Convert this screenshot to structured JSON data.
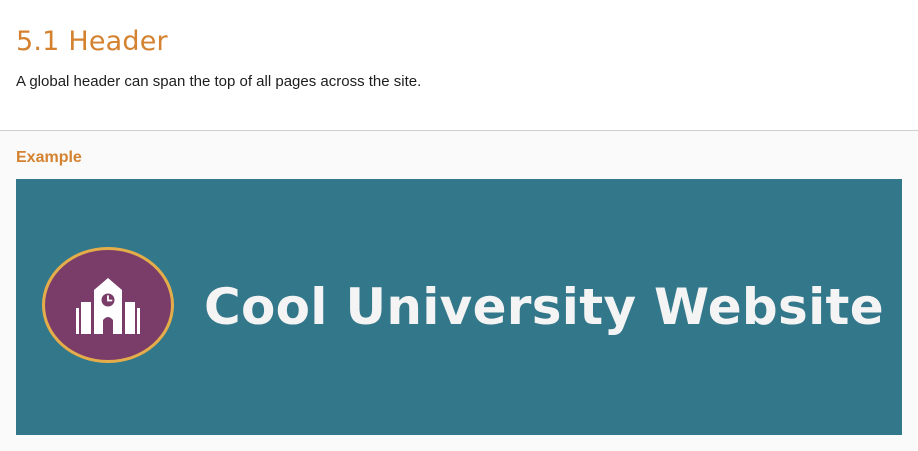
{
  "section": {
    "title": "5.1 Header",
    "description": "A global header can span the top of all pages across the site."
  },
  "example": {
    "label": "Example",
    "header": {
      "logo_icon": "school-building-icon",
      "site_title": "Cool University Website"
    }
  },
  "colors": {
    "accent_orange": "#d4822f",
    "banner_teal": "#33778a",
    "logo_purple": "#7a3d69",
    "logo_ring_gold": "#e5ad4a",
    "title_white": "#f4f4f4"
  }
}
